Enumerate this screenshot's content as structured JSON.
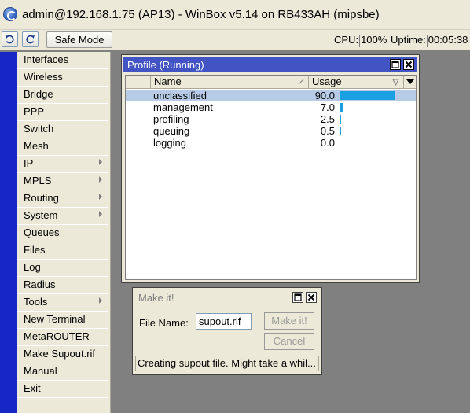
{
  "window": {
    "title": "admin@192.168.1.75 (AP13) - WinBox v5.14 on RB433AH (mipsbe)"
  },
  "toolbar": {
    "safe_mode_label": "Safe Mode",
    "cpu_label": "CPU:",
    "cpu_value": "100%",
    "uptime_label": "Uptime:",
    "uptime_value": "00:05:38"
  },
  "sidebar": {
    "items": [
      {
        "label": "Interfaces",
        "submenu": false
      },
      {
        "label": "Wireless",
        "submenu": false
      },
      {
        "label": "Bridge",
        "submenu": false
      },
      {
        "label": "PPP",
        "submenu": false
      },
      {
        "label": "Switch",
        "submenu": false
      },
      {
        "label": "Mesh",
        "submenu": false
      },
      {
        "label": "IP",
        "submenu": true
      },
      {
        "label": "MPLS",
        "submenu": true
      },
      {
        "label": "Routing",
        "submenu": true
      },
      {
        "label": "System",
        "submenu": true
      },
      {
        "label": "Queues",
        "submenu": false
      },
      {
        "label": "Files",
        "submenu": false
      },
      {
        "label": "Log",
        "submenu": false
      },
      {
        "label": "Radius",
        "submenu": false
      },
      {
        "label": "Tools",
        "submenu": true
      },
      {
        "label": "New Terminal",
        "submenu": false
      },
      {
        "label": "MetaROUTER",
        "submenu": false
      },
      {
        "label": "Make Supout.rif",
        "submenu": false
      },
      {
        "label": "Manual",
        "submenu": false
      },
      {
        "label": "Exit",
        "submenu": false
      }
    ]
  },
  "profile_window": {
    "title": "Profile (Running)",
    "columns": {
      "name": "Name",
      "usage": "Usage"
    },
    "rows": [
      {
        "name": "unclassified",
        "usage": "90.0",
        "usage_fraction": 0.9,
        "selected": true
      },
      {
        "name": "management",
        "usage": "7.0",
        "usage_fraction": 0.07,
        "selected": false
      },
      {
        "name": "profiling",
        "usage": "2.5",
        "usage_fraction": 0.025,
        "selected": false
      },
      {
        "name": "queuing",
        "usage": "0.5",
        "usage_fraction": 0.005,
        "selected": false
      },
      {
        "name": "logging",
        "usage": "0.0",
        "usage_fraction": 0.0,
        "selected": false
      }
    ]
  },
  "makeit_window": {
    "title": "Make it!",
    "file_name_label": "File Name:",
    "file_name_value": "supout.rif",
    "make_button": "Make it!",
    "cancel_button": "Cancel",
    "status": "Creating supout file. Might take a whil..."
  },
  "colors": {
    "sidebar_bar": "#1727c6",
    "active_title": "#4253c4",
    "usage_bar": "#1a9fe0",
    "selected_row": "#b8cbe6"
  }
}
